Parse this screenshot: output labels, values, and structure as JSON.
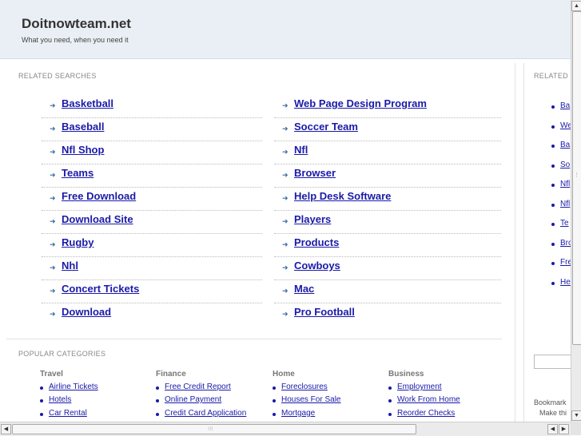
{
  "header": {
    "title": "Doitnowteam.net",
    "tagline": "What you need, when you need it"
  },
  "related": {
    "label": "RELATED SEARCHES",
    "left": [
      "Basketball",
      "Baseball",
      "Nfl Shop",
      "Teams",
      "Free Download",
      "Download Site",
      "Rugby",
      "Nhl",
      "Concert Tickets",
      "Download"
    ],
    "right": [
      "Web Page Design Program",
      "Soccer Team",
      "Nfl",
      "Browser",
      "Help Desk Software",
      "Players",
      "Products",
      "Cowboys",
      "Mac",
      "Pro Football"
    ]
  },
  "popular": {
    "label": "POPULAR CATEGORIES",
    "categories": [
      {
        "title": "Travel",
        "items": [
          "Airline Tickets",
          "Hotels",
          "Car Rental"
        ]
      },
      {
        "title": "Finance",
        "items": [
          "Free Credit Report",
          "Online Payment",
          "Credit Card Application"
        ]
      },
      {
        "title": "Home",
        "items": [
          "Foreclosures",
          "Houses For Sale",
          "Mortgage"
        ]
      },
      {
        "title": "Business",
        "items": [
          "Employment",
          "Work From Home",
          "Reorder Checks"
        ]
      }
    ]
  },
  "sidebar": {
    "label": "RELATED",
    "items": [
      "Ba",
      "We",
      "Ba",
      "So",
      "Nfl",
      "Nfl",
      "Te",
      "Bro",
      "Fre",
      "He"
    ],
    "bookmark": "Bookmark",
    "make": "Make thi"
  },
  "icons": {
    "arrow": "right-arrow-icon",
    "bullet": "bullet-icon"
  },
  "colors": {
    "link": "#1a1aa8",
    "header_bg": "#e9eff4"
  }
}
